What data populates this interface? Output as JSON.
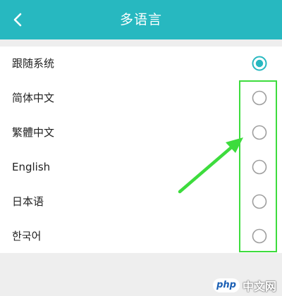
{
  "header": {
    "title": "多语言",
    "back_icon": "chevron-left-icon"
  },
  "colors": {
    "app_bar": "#27b8c0",
    "radio_selected": "#27b8c0",
    "radio_unselected": "#9e9e9e",
    "annotation": "#3ddc3d"
  },
  "languages": [
    {
      "label": "跟随系统",
      "selected": true
    },
    {
      "label": "简体中文",
      "selected": false
    },
    {
      "label": "繁體中文",
      "selected": false
    },
    {
      "label": "English",
      "selected": false
    },
    {
      "label": "日本语",
      "selected": false
    },
    {
      "label": "한국어",
      "selected": false
    }
  ],
  "watermark": {
    "logo": "php",
    "text": "中文网"
  }
}
